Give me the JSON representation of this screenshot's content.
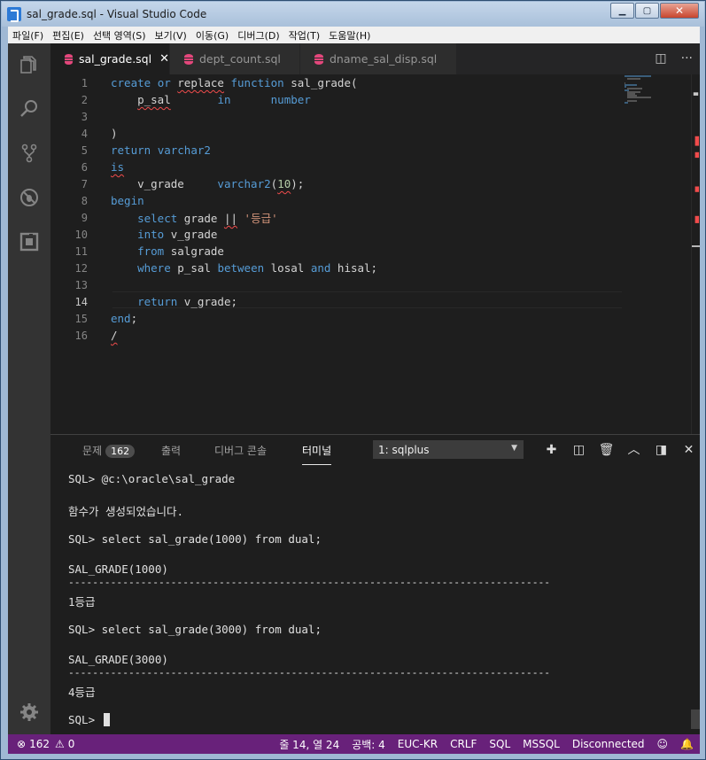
{
  "window": {
    "title": "sal_grade.sql - Visual Studio Code"
  },
  "menu": [
    "파일(F)",
    "편집(E)",
    "선택 영역(S)",
    "보기(V)",
    "이동(G)",
    "디버그(D)",
    "작업(T)",
    "도움말(H)"
  ],
  "tabs": [
    {
      "label": "sal_grade.sql",
      "active": true
    },
    {
      "label": "dept_count.sql",
      "active": false
    },
    {
      "label": "dname_sal_disp.sql",
      "active": false
    }
  ],
  "editor": {
    "current_line": 14,
    "line_numbers": [
      "1",
      "2",
      "3",
      "4",
      "5",
      "6",
      "7",
      "8",
      "9",
      "10",
      "11",
      "12",
      "13",
      "14",
      "15",
      "16"
    ]
  },
  "panel": {
    "tabs": {
      "problems": "문제",
      "problems_count": "162",
      "output": "출력",
      "debug_console": "디버그 콘솔",
      "terminal": "터미널"
    },
    "terminal_select": "1: sqlplus",
    "terminal_lines": [
      "SQL> @c:\\oracle\\sal_grade",
      "함수가 생성되었습니다.",
      "SQL> select sal_grade(1000) from dual;",
      "SAL_GRADE(1000)",
      "--------------------------------------------------------------------------------",
      "1등급",
      "SQL> select sal_grade(3000) from dual;",
      "SAL_GRADE(3000)",
      "--------------------------------------------------------------------------------",
      "4등급",
      "SQL> "
    ]
  },
  "status": {
    "errors": "162",
    "warnings": "0",
    "position": "줄 14, 열 24",
    "indent": "공백: 4",
    "encoding": "EUC-KR",
    "eol": "CRLF",
    "language": "SQL",
    "dialect": "MSSQL",
    "connection": "Disconnected"
  },
  "colors": {
    "statusbar": "#68217a",
    "activitybar": "#333333",
    "editor_bg": "#1e1e1e",
    "keyword": "#569cd6",
    "string": "#ce9178"
  }
}
